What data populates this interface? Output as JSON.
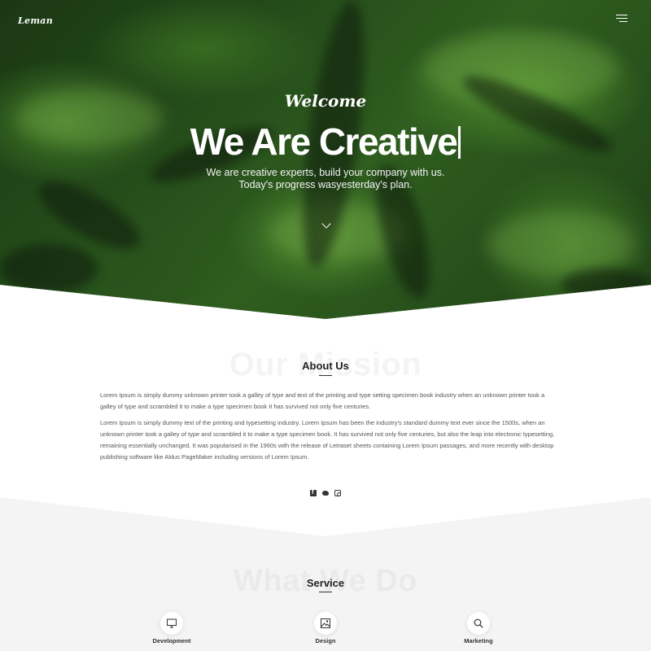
{
  "header": {
    "logo": "Leman",
    "menu_icon": "hamburger-menu-icon"
  },
  "hero": {
    "welcome": "Welcome",
    "headline": "We Are Creative",
    "sub_line_1": "We are creative experts, build your company with us.",
    "sub_line_2": "Today's progress wasyesterday's plan.",
    "scroll_icon": "chevron-down-icon"
  },
  "about": {
    "background_title": "Our Mission",
    "title": "About Us",
    "paragraph_1": "Lorem Ipsum is simply dummy unknown printer took a galley of type and text of the printing and type setting specimen book industry when an unknown printer took a galley of type and scrambled it to make a type specimen book It has survived not only five centuries.",
    "paragraph_2": "Lorem Ipsum is simply dummy text of the printing and typesetting industry. Lorem Ipsum has been the industry's standard dummy text ever since the 1500s, when an unknown printer took a galley of type and scrambled it to make a type specimen book. It has survived not only five centuries, but also the leap into electronic typesetting, remaining essentially unchanged. It was popularised in the 1960s with the release of Letraset sheets containing Lorem Ipsum passages, and more recently with desktop publishing software like Aldus PageMaker including versions of Lorem Ipsum.",
    "social_icons": [
      "facebook-icon",
      "twitter-icon",
      "instagram-icon"
    ]
  },
  "service": {
    "background_title": "What We Do",
    "title": "Service",
    "items": [
      {
        "label": "Development",
        "icon": "monitor-icon"
      },
      {
        "label": "Design",
        "icon": "image-icon"
      },
      {
        "label": "Marketing",
        "icon": "search-icon"
      }
    ]
  },
  "colors": {
    "hero_green": "#366b24",
    "service_background": "#f4f4f4",
    "text_dark": "#222222"
  }
}
